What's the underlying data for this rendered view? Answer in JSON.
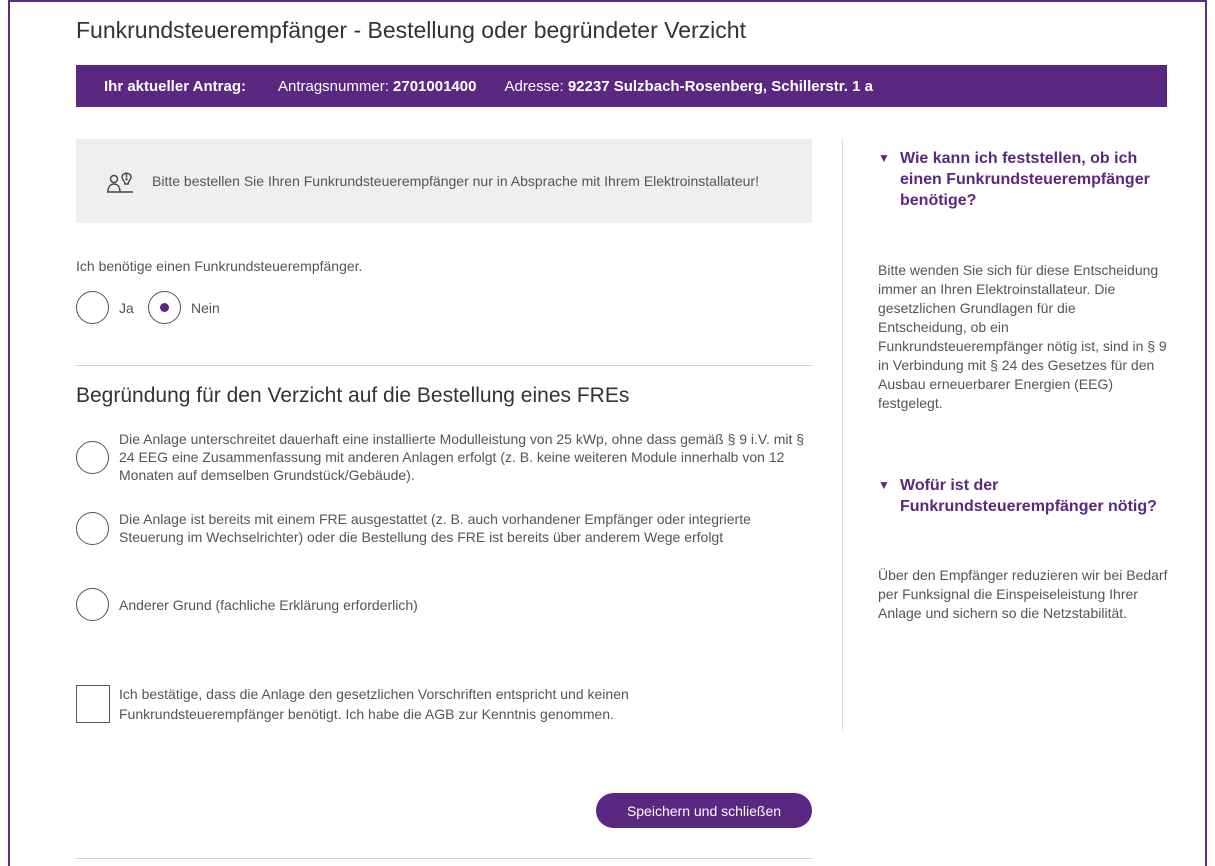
{
  "page": {
    "title": "Funkrundsteuerempfänger - Bestellung oder begründeter Verzicht"
  },
  "antrag": {
    "label": "Ihr aktueller Antrag:",
    "number_label": "Antragsnummer:",
    "number_value": "2701001400",
    "address_label": "Adresse:",
    "address_value": "92237 Sulzbach-Rosenberg, Schillerstr. 1 a"
  },
  "notice": {
    "icon": "electrician-icon",
    "text": "Bitte bestellen Sie Ihren Funkrundsteuerempfänger nur in Absprache mit Ihrem Elektroinstallateur!"
  },
  "need_question": {
    "text": "Ich benötige einen Funkrundsteuerempfänger.",
    "options": [
      {
        "label": "Ja",
        "selected": false
      },
      {
        "label": "Nein",
        "selected": true
      }
    ]
  },
  "waiver": {
    "title": "Begründung für den Verzicht auf die Bestellung eines FREs",
    "reasons": [
      {
        "text": "Die Anlage unterschreitet dauerhaft eine installierte Modulleistung von 25 kWp, ohne dass gemäß § 9 i.V. mit § 24 EEG eine Zusammenfassung mit anderen Anlagen erfolgt (z. B. keine weiteren Module innerhalb von 12 Monaten auf demselben Grundstück/Gebäude).",
        "selected": false
      },
      {
        "text": "Die Anlage ist bereits mit einem FRE ausgestattet (z. B. auch vorhandener Empfänger oder integrierte Steuerung im Wechselrichter) oder die Bestellung des FRE ist bereits über anderem Wege erfolgt",
        "selected": false
      },
      {
        "text": "Anderer Grund (fachliche Erklärung erforderlich)",
        "selected": false
      }
    ]
  },
  "confirm": {
    "text": "Ich bestätige, dass die Anlage den gesetzlichen Vorschriften entspricht und keinen Funkrundsteuerempfänger benötigt. Ich habe die AGB zur Kenntnis genommen.",
    "checked": false
  },
  "actions": {
    "save_label": "Speichern und schließen"
  },
  "faq": [
    {
      "question": "Wie kann ich feststellen, ob ich einen Funkrundsteuerempfänger benötige?",
      "answer": "Bitte wenden Sie sich für diese Entscheidung immer an Ihren Elektroinstallateur. Die gesetzlichen Grundlagen für die Entscheidung, ob ein Funkrundsteuerempfänger nötig ist, sind in § 9 in Verbindung mit § 24 des Gesetzes für den Ausbau erneuerbarer Energien (EEG) festgelegt."
    },
    {
      "question": "Wofür ist der Funkrundsteuerempfänger nötig?",
      "answer": "Über den Empfänger reduzieren wir bei Bedarf per Funksignal die Einspeiseleistung Ihrer Anlage und sichern so die Netzstabilität."
    }
  ],
  "colors": {
    "brand": "#5a2781",
    "notice_bg": "#efefef"
  }
}
